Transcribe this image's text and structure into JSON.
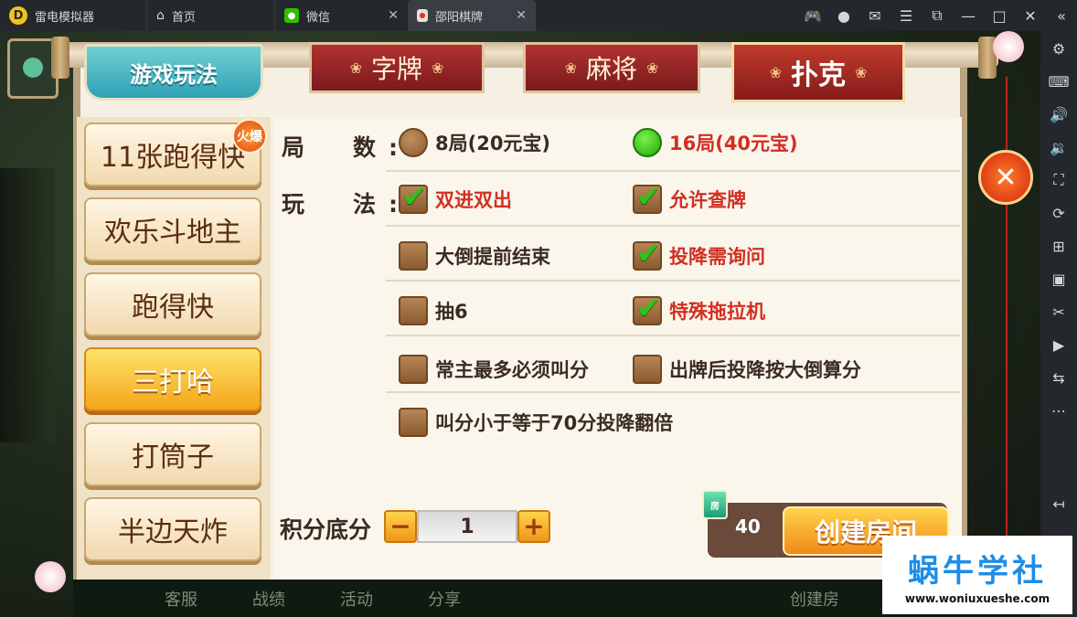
{
  "window": {
    "app_name": "雷电模拟器",
    "tabs": [
      {
        "label": "首页",
        "icon": "home-icon"
      },
      {
        "label": "微信",
        "icon": "wechat-icon"
      },
      {
        "label": "邵阳棋牌",
        "icon": "game-icon"
      }
    ],
    "controls": [
      "gamepad-icon",
      "user-icon",
      "mail-icon",
      "menu-icon",
      "restore-icon",
      "minimize-icon",
      "maximize-icon",
      "close-icon",
      "collapse-icon"
    ]
  },
  "side_toolbar": [
    "settings-icon",
    "keyboard-icon",
    "volume-up-icon",
    "volume-down-icon",
    "screenshot-icon",
    "rotate-icon",
    "add-icon",
    "apk-icon",
    "scissors-icon",
    "video-icon",
    "sync-icon",
    "more-icon",
    "back-icon"
  ],
  "game": {
    "section_title": "游戏玩法",
    "categories": [
      "字牌",
      "麻将",
      "扑克"
    ],
    "games": [
      {
        "label": "11张跑得快",
        "badge": "火爆"
      },
      {
        "label": "欢乐斗地主"
      },
      {
        "label": "跑得快"
      },
      {
        "label": "三打哈"
      },
      {
        "label": "打筒子"
      },
      {
        "label": "半边天炸"
      }
    ],
    "rounds_label": "局　数:",
    "rounds": [
      {
        "label": "8局(20元宝)",
        "selected": false
      },
      {
        "label": "16局(40元宝)",
        "selected": true
      }
    ],
    "rules_label": "玩　法:",
    "rules": [
      {
        "label": "双进双出",
        "checked": true
      },
      {
        "label": "允许查牌",
        "checked": true
      },
      {
        "label": "大倒提前结束",
        "checked": false
      },
      {
        "label": "投降需询问",
        "checked": true
      },
      {
        "label": "抽6",
        "checked": false
      },
      {
        "label": "特殊拖拉机",
        "checked": true
      },
      {
        "label": "常主最多必须叫分",
        "checked": false
      },
      {
        "label": "出牌后投降按大倒算分",
        "checked": false
      },
      {
        "label": "叫分小于等于70分投降翻倍",
        "checked": false
      }
    ],
    "score_label": "积分底分",
    "score_value": "1",
    "minus": "−",
    "plus": "+",
    "cost": "40",
    "cost_icon_text": "房",
    "create_label": "创建房间",
    "close_symbol": "✕",
    "bottom_nav": [
      "客服",
      "战绩",
      "活动",
      "分享",
      "创建房"
    ]
  },
  "watermark": {
    "title": "蜗牛学社",
    "url": "www.woniuxueshe.com"
  }
}
